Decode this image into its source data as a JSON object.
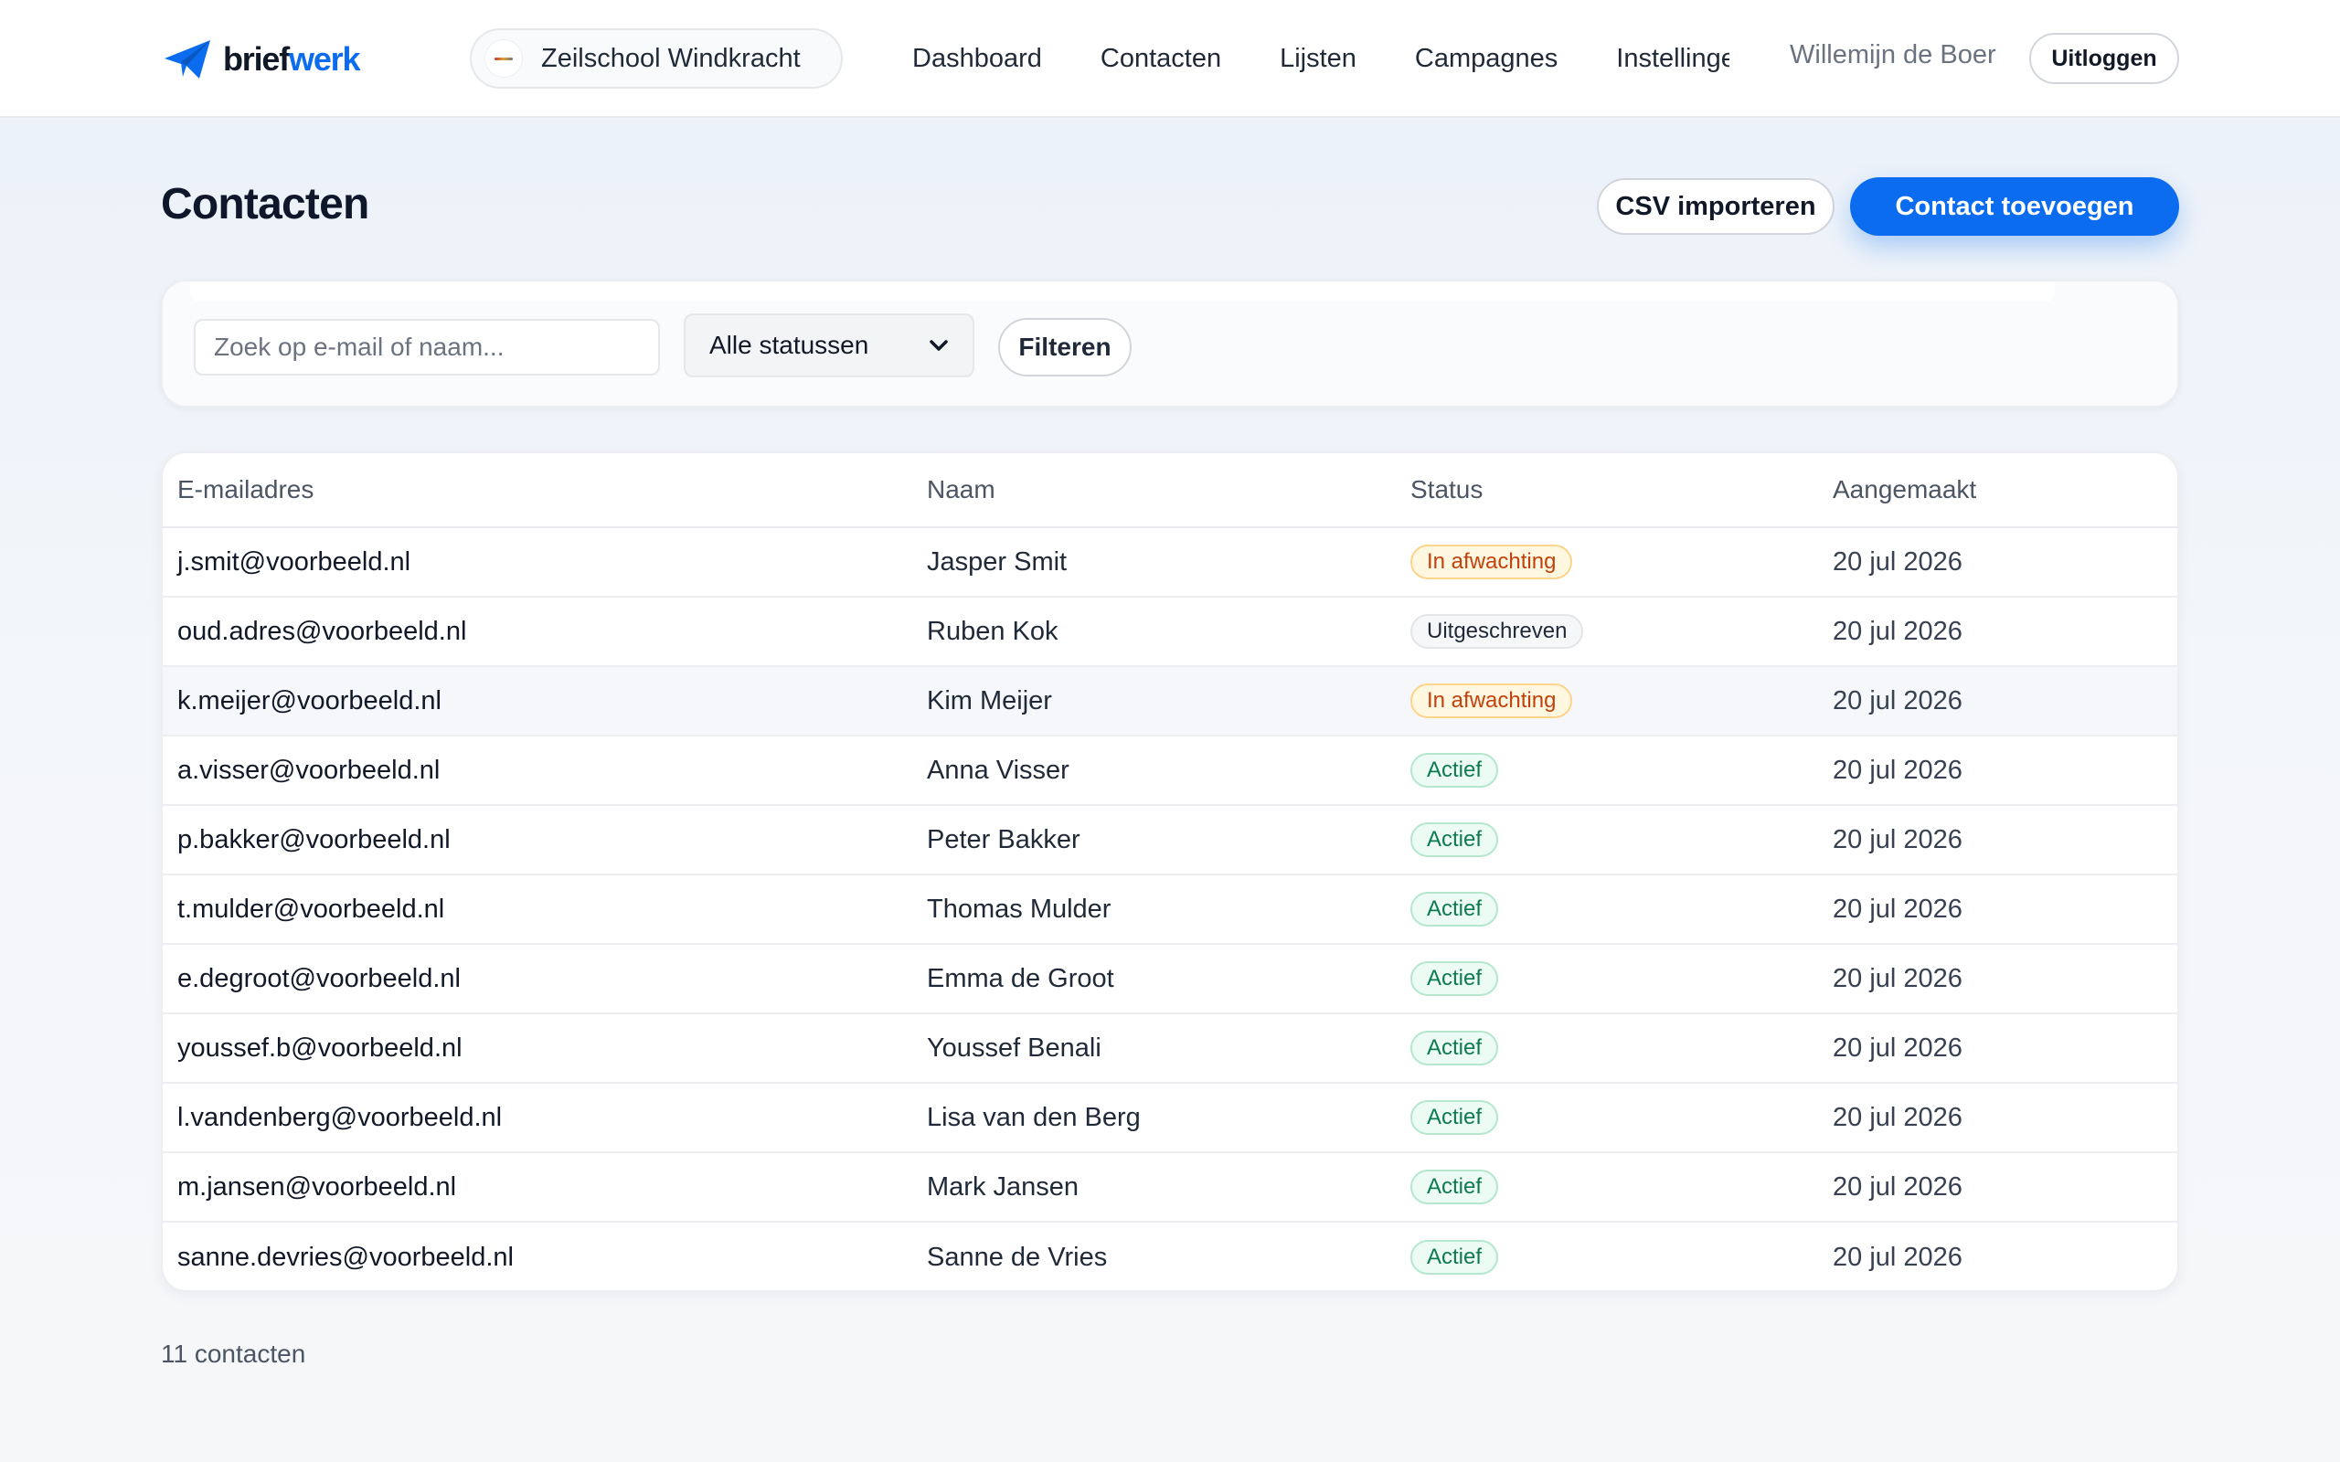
{
  "brand": {
    "part1": "brief",
    "part2": "werk"
  },
  "org": {
    "name": "Zeilschool Windkracht"
  },
  "nav": [
    {
      "label": "Dashboard"
    },
    {
      "label": "Contacten"
    },
    {
      "label": "Lijsten"
    },
    {
      "label": "Campagnes"
    },
    {
      "label": "Instellingen"
    }
  ],
  "user": {
    "name": "Willemijn de Boer",
    "logout_label": "Uitloggen"
  },
  "page": {
    "title": "Contacten",
    "import_label": "CSV importeren",
    "add_label": "Contact toevoegen"
  },
  "filter": {
    "search_placeholder": "Zoek op e-mail of naam...",
    "search_value": "",
    "status_selected": "Alle statussen",
    "filter_label": "Filteren"
  },
  "table": {
    "columns": [
      "E-mailadres",
      "Naam",
      "Status",
      "Aangemaakt"
    ],
    "rows": [
      {
        "email": "j.smit@voorbeeld.nl",
        "name": "Jasper Smit",
        "status": "In afwachting",
        "created": "20 jul 2026"
      },
      {
        "email": "oud.adres@voorbeeld.nl",
        "name": "Ruben Kok",
        "status": "Uitgeschreven",
        "created": "20 jul 2026"
      },
      {
        "email": "k.meijer@voorbeeld.nl",
        "name": "Kim Meijer",
        "status": "In afwachting",
        "created": "20 jul 2026"
      },
      {
        "email": "a.visser@voorbeeld.nl",
        "name": "Anna Visser",
        "status": "Actief",
        "created": "20 jul 2026"
      },
      {
        "email": "p.bakker@voorbeeld.nl",
        "name": "Peter Bakker",
        "status": "Actief",
        "created": "20 jul 2026"
      },
      {
        "email": "t.mulder@voorbeeld.nl",
        "name": "Thomas Mulder",
        "status": "Actief",
        "created": "20 jul 2026"
      },
      {
        "email": "e.degroot@voorbeeld.nl",
        "name": "Emma de Groot",
        "status": "Actief",
        "created": "20 jul 2026"
      },
      {
        "email": "youssef.b@voorbeeld.nl",
        "name": "Youssef Benali",
        "status": "Actief",
        "created": "20 jul 2026"
      },
      {
        "email": "l.vandenberg@voorbeeld.nl",
        "name": "Lisa van den Berg",
        "status": "Actief",
        "created": "20 jul 2026"
      },
      {
        "email": "m.jansen@voorbeeld.nl",
        "name": "Mark Jansen",
        "status": "Actief",
        "created": "20 jul 2026"
      },
      {
        "email": "sanne.devries@voorbeeld.nl",
        "name": "Sanne de Vries",
        "status": "Actief",
        "created": "20 jul 2026"
      }
    ]
  },
  "footer": {
    "count_text": "11 contacten"
  },
  "colors": {
    "accent": "#0b6cf0",
    "status_pending": "#c2410c",
    "status_active": "#0e7a4f",
    "status_unsubscribed": "#1f2937"
  },
  "icons": {
    "brand": "paper-plane-icon",
    "select": "chevron-down-icon"
  }
}
